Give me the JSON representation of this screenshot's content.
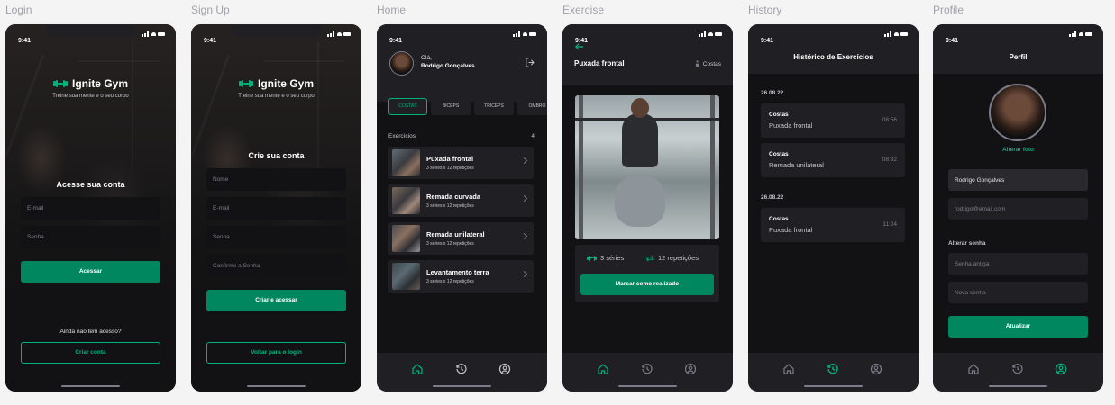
{
  "frames": {
    "login": "Login",
    "signup": "Sign Up",
    "home": "Home",
    "exercise": "Exercise",
    "history": "History",
    "profile": "Profile"
  },
  "status": {
    "time": "9:41"
  },
  "brand": {
    "name": "Ignite Gym",
    "tagline": "Treine sua mente e o seu corpo"
  },
  "login": {
    "title": "Acesse sua conta",
    "email_placeholder": "E-mail",
    "password_placeholder": "Senha",
    "submit": "Acessar",
    "no_account": "Ainda não tem acesso?",
    "create_account": "Criar conta"
  },
  "signup": {
    "title": "Crie sua conta",
    "name_placeholder": "Nome",
    "email_placeholder": "E-mail",
    "password_placeholder": "Senha",
    "confirm_placeholder": "Confirme  a Senha",
    "submit": "Criar e acessar",
    "back": "Voltar para o login"
  },
  "home": {
    "greeting": "Olá,",
    "user_name": "Rodrigo Gonçalves",
    "groups": [
      "costas",
      "bíceps",
      "tríceps",
      "ombro"
    ],
    "exercises_label": "Exercícios",
    "exercises_count": "4",
    "exercises": [
      {
        "name": "Puxada frontal",
        "meta": "3 séries x 12 repetições"
      },
      {
        "name": "Remada curvada",
        "meta": "3 séries x 12 repetições"
      },
      {
        "name": "Remada unilateral",
        "meta": "3 séries x 12 repetições"
      },
      {
        "name": "Levantamento terra",
        "meta": "3 séries x 12 repetições"
      }
    ]
  },
  "exercise": {
    "title": "Puxada frontal",
    "group": "Costas",
    "series": "3 séries",
    "reps": "12 repetições",
    "done_button": "Marcar como realizado"
  },
  "history": {
    "title": "Histórico de Exercícios",
    "sections": [
      {
        "date": "26.08.22",
        "items": [
          {
            "group": "Costas",
            "name": "Puxada frontal",
            "time": "08:56"
          },
          {
            "group": "Costas",
            "name": "Remada unilateral",
            "time": "08:32"
          }
        ]
      },
      {
        "date": "26.08.22",
        "items": [
          {
            "group": "Costas",
            "name": "Puxada frontal",
            "time": "11:24"
          }
        ]
      }
    ]
  },
  "profile": {
    "title": "Perfil",
    "change_photo": "Alterar foto",
    "name_value": "Rodrigo Gonçalves",
    "email_value": "rodrigo@email.com",
    "change_password_label": "Alterar senha",
    "old_password_placeholder": "Senha antiga",
    "new_password_placeholder": "Nova senha",
    "update_button": "Atualizar"
  },
  "colors": {
    "accent": "#00b37e",
    "accent_dark": "#00875f",
    "background": "#121214",
    "surface": "#202024"
  },
  "icons": {
    "tabs": [
      "home-icon",
      "history-icon",
      "profile-icon"
    ],
    "logout": "logout-icon",
    "back": "arrow-left-icon",
    "group": "body-icon",
    "series": "dumbbell-icon",
    "reps": "repeat-icon"
  }
}
